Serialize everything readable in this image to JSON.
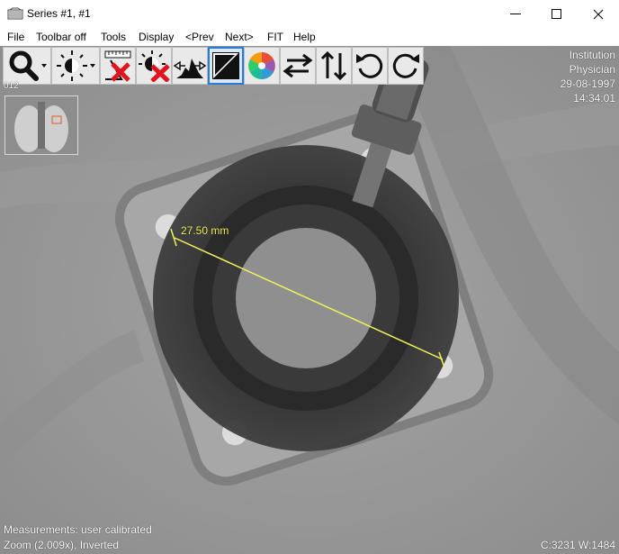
{
  "window": {
    "title": "Series #1, #1",
    "controls": [
      "minimize",
      "maximize",
      "close"
    ]
  },
  "menu": {
    "items": [
      {
        "label": "File"
      },
      {
        "label": "Toolbar off"
      },
      {
        "label": "Tools"
      },
      {
        "label": "Display"
      },
      {
        "label": "<Prev"
      },
      {
        "label": "Next>"
      },
      {
        "label": "FIT"
      },
      {
        "label": "Help"
      }
    ]
  },
  "toolbar": {
    "buttons": [
      {
        "icon": "zoom-icon"
      },
      {
        "icon": "brightness-contrast-icon"
      },
      {
        "icon": "remove-measurements-icon"
      },
      {
        "icon": "reset-brightness-icon"
      },
      {
        "icon": "histogram-icon"
      },
      {
        "icon": "invert-icon",
        "active": true
      },
      {
        "icon": "color-palette-icon"
      },
      {
        "icon": "flip-horizontal-icon"
      },
      {
        "icon": "flip-vertical-icon"
      },
      {
        "icon": "rotate-left-icon"
      },
      {
        "icon": "rotate-right-icon"
      }
    ]
  },
  "overlay": {
    "top_left": "012",
    "top_right": [
      "Institution",
      "Physician",
      "29-08-1997",
      "14:34:01"
    ],
    "measurement": "27.50 mm",
    "bottom_left": [
      "Measurements: user calibrated",
      "Zoom (2.009x), Inverted"
    ],
    "bottom_right": "C:3231 W:1484"
  },
  "colors": {
    "measure_line": "#f2f25a",
    "active_border": "#2b79d8"
  }
}
